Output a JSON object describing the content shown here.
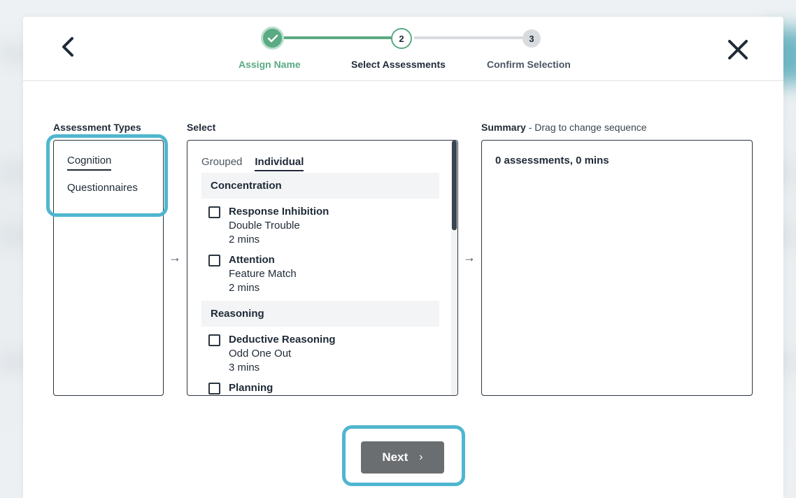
{
  "stepper": {
    "steps": [
      {
        "number": "",
        "label": "Assign Name",
        "status": "complete"
      },
      {
        "number": "2",
        "label": "Select Assessments",
        "status": "current"
      },
      {
        "number": "3",
        "label": "Confirm Selection",
        "status": "upcoming"
      }
    ]
  },
  "columns": {
    "types_title": "Assessment Types",
    "select_title": "Select",
    "summary_title": "Summary",
    "summary_subtitle": " - Drag to change sequence"
  },
  "assessment_types": [
    "Cognition",
    "Questionnaires"
  ],
  "select": {
    "tabs": [
      "Grouped",
      "Individual"
    ],
    "active_tab": "Individual",
    "groups": [
      {
        "name": "Concentration",
        "items": [
          {
            "name": "Response Inhibition",
            "test": "Double Trouble",
            "duration": "2 mins"
          },
          {
            "name": "Attention",
            "test": "Feature Match",
            "duration": "2 mins"
          }
        ]
      },
      {
        "name": "Reasoning",
        "items": [
          {
            "name": "Deductive Reasoning",
            "test": "Odd One Out",
            "duration": "3 mins"
          },
          {
            "name": "Planning",
            "test": "",
            "duration": ""
          }
        ]
      }
    ]
  },
  "summary": {
    "text": "0 assessments, 0 mins"
  },
  "arrows": {
    "glyph": "→"
  },
  "footer": {
    "next_label": "Next",
    "next_chevron": "›"
  },
  "colors": {
    "accent_green": "#5aaa84",
    "highlight_teal": "#4fb6cf",
    "next_button": "#6b6e71"
  }
}
